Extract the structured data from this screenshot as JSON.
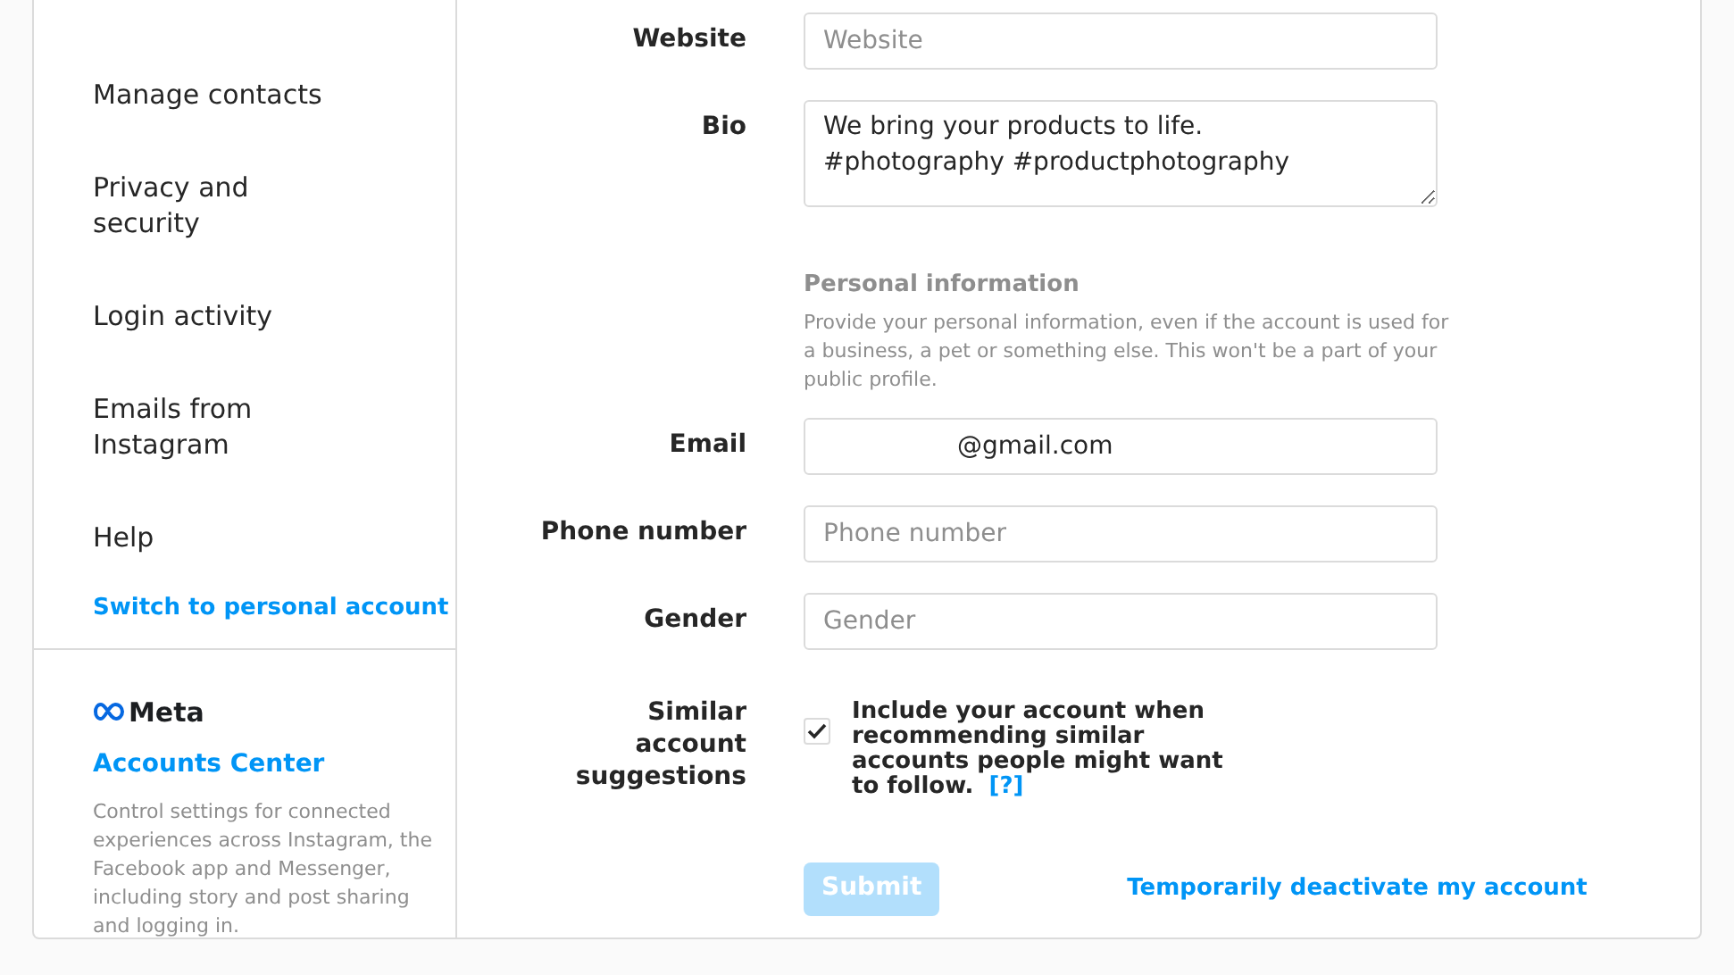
{
  "sidebar": {
    "items": [
      {
        "label": "Manage contacts",
        "selected": false
      },
      {
        "label": "Privacy and security",
        "selected": false
      },
      {
        "label": "Login activity",
        "selected": false
      },
      {
        "label": "Emails from Instagram",
        "selected": false
      },
      {
        "label": "Help",
        "selected": false
      }
    ],
    "switch_link": "Switch to personal account",
    "meta": {
      "brand": "Meta",
      "title": "Accounts Center",
      "description": "Control settings for connected experiences across Instagram, the Facebook app and Messenger, including story and post sharing and logging in."
    }
  },
  "form": {
    "fields": [
      {
        "kind": "input",
        "label": "Website",
        "placeholder": "Website"
      },
      {
        "kind": "textarea",
        "label": "Bio",
        "value": "We bring your products to life.\n#photography #productphotography"
      },
      {
        "kind": "section",
        "heading": "Personal information",
        "description": "Provide your personal information, even if the account is used for a business, a pet or something else. This won't be a part of your public profile."
      },
      {
        "kind": "input",
        "label": "Email",
        "value": "@gmail.com"
      },
      {
        "kind": "input",
        "label": "Phone number",
        "placeholder": "Phone number"
      },
      {
        "kind": "input",
        "label": "Gender",
        "placeholder": "Gender"
      },
      {
        "kind": "checkbox",
        "label": "Similar account suggestions",
        "text": "Include your account when recommending similar accounts people might want to follow.",
        "help": "[?]",
        "checked": true
      }
    ],
    "submit": {
      "label": "Submit",
      "disabled": true
    },
    "deactivate_link": "Temporarily deactivate my account"
  }
}
